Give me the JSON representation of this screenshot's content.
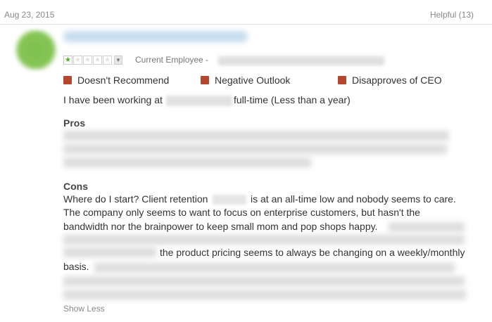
{
  "review": {
    "date": "Aug 23, 2015",
    "helpful": "Helpful (13)",
    "rating": {
      "value": 1,
      "max": 5
    },
    "employee_label": "Current Employee -",
    "flags": [
      "Doesn't Recommend",
      "Negative Outlook",
      "Disapproves of CEO"
    ],
    "working_prefix": "I have been working at",
    "working_suffix": "full-time (Less than a year)",
    "pros_label": "Pros",
    "cons_label": "Cons",
    "cons_line1_a": "Where do I start? Client retention",
    "cons_line1_b": "is at an all-time low and nobody seems to care.",
    "cons_line2": "The company only seems to want to focus on enterprise customers, but hasn't the",
    "cons_line3": "bandwidth nor the brainpower to keep small mom and pop shops happy.",
    "cons_line4": "the product pricing seems to always be changing on a weekly/monthly",
    "cons_line5": "basis.",
    "show_less": "Show Less"
  },
  "colors": {
    "flag": "#b6472f",
    "star_on": "#4caf2a",
    "text": "#333333",
    "muted": "#888888"
  }
}
